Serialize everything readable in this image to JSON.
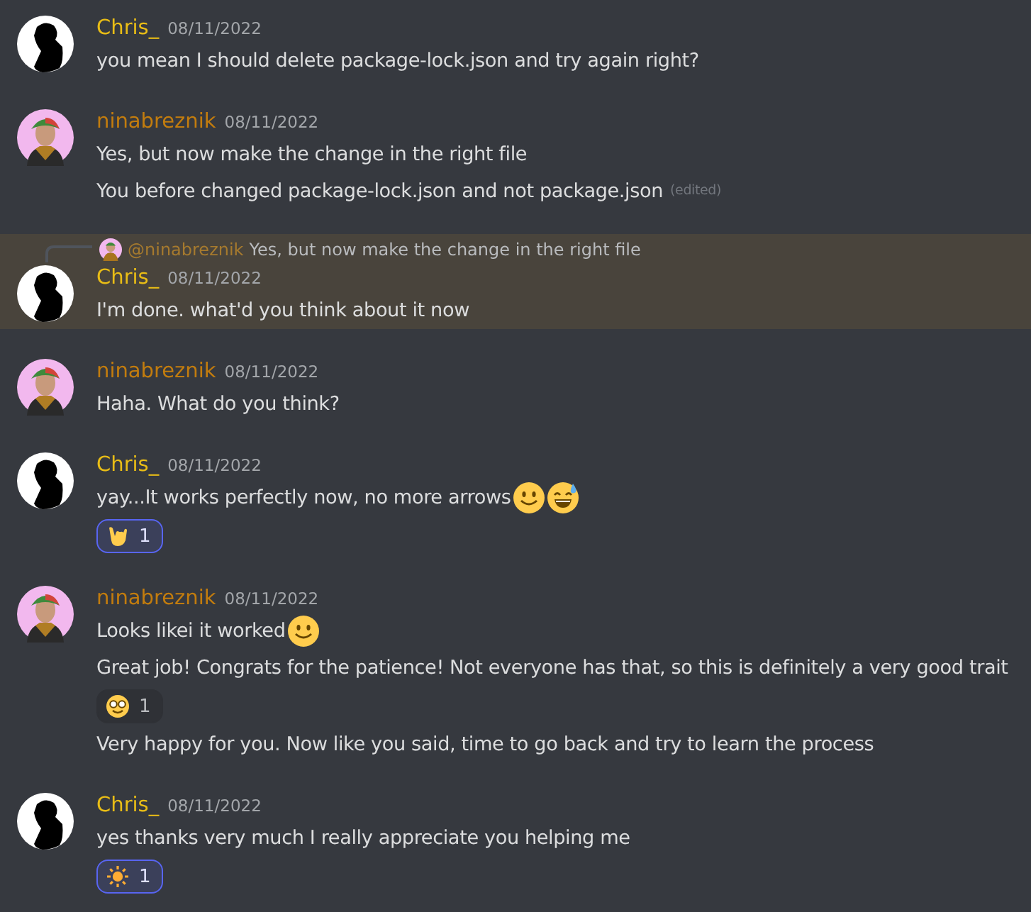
{
  "messages": [
    {
      "author": "Chris_",
      "color": "#e9bd16",
      "avatar": {
        "kind": "silhouette"
      },
      "timestamp": "08/11/2022",
      "highlighted": false,
      "lines": [
        {
          "text": "you mean I should delete package-lock.json and try again right?"
        }
      ]
    },
    {
      "author": "ninabreznik",
      "color": "#c27c0e",
      "avatar": {
        "kind": "person"
      },
      "timestamp": "08/11/2022",
      "highlighted": false,
      "lines": [
        {
          "text": "Yes, but now make the change in the right file"
        },
        {
          "text": "You before changed package-lock.json and not package.json",
          "edited": "(edited)"
        }
      ]
    },
    {
      "author": "Chris_",
      "color": "#e9bd16",
      "avatar": {
        "kind": "silhouette"
      },
      "timestamp": "08/11/2022",
      "highlighted": true,
      "reply": {
        "avatar": {
          "kind": "person"
        },
        "mention": "@ninabreznik",
        "text": "Yes, but now make the change in the right file"
      },
      "lines": [
        {
          "text": "I'm done. what'd you think about it now"
        }
      ]
    },
    {
      "author": "ninabreznik",
      "color": "#c27c0e",
      "avatar": {
        "kind": "person"
      },
      "timestamp": "08/11/2022",
      "highlighted": false,
      "lines": [
        {
          "text": "Haha. What do you think?"
        }
      ]
    },
    {
      "author": "Chris_",
      "color": "#e9bd16",
      "avatar": {
        "kind": "silhouette"
      },
      "timestamp": "08/11/2022",
      "highlighted": false,
      "lines": [
        {
          "text": "yay...It works perfectly now, no more arrows",
          "emojis": [
            {
              "kind": "smile"
            },
            {
              "kind": "sweat-smile"
            }
          ],
          "reactions": [
            {
              "kind": "horns-hand",
              "count": "1",
              "selected": true
            }
          ]
        }
      ]
    },
    {
      "author": "ninabreznik",
      "color": "#c27c0e",
      "avatar": {
        "kind": "person"
      },
      "timestamp": "08/11/2022",
      "highlighted": false,
      "lines": [
        {
          "text": "Looks likei it worked ",
          "emojis": [
            {
              "kind": "smile"
            }
          ]
        },
        {
          "text": "Great job! Congrats for the patience! Not everyone has that, so this is definitely a very good trait",
          "reactions": [
            {
              "kind": "nerd",
              "count": "1",
              "selected": false
            }
          ]
        },
        {
          "text": "Very happy for you. Now like you said, time to go back and try to learn the process"
        }
      ]
    },
    {
      "author": "Chris_",
      "color": "#e9bd16",
      "avatar": {
        "kind": "silhouette"
      },
      "timestamp": "08/11/2022",
      "highlighted": false,
      "lines": [
        {
          "text": "yes thanks very much I really appreciate you helping me",
          "reactions": [
            {
              "kind": "sun",
              "count": "1",
              "selected": true
            }
          ]
        }
      ]
    }
  ]
}
